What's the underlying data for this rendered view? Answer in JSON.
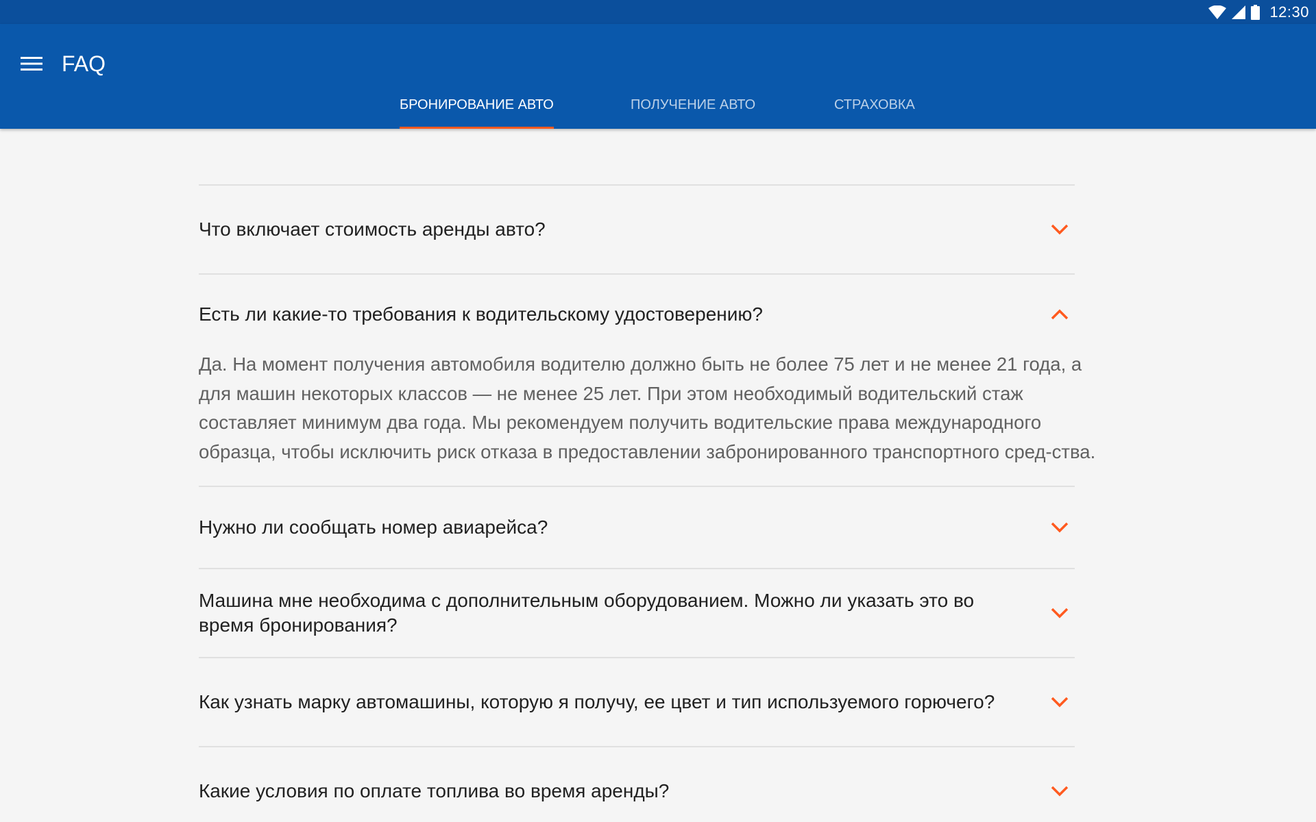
{
  "status_bar": {
    "time": "12:30",
    "icons": [
      "wifi-icon",
      "cell-signal-icon",
      "battery-icon"
    ]
  },
  "app_bar": {
    "title": "FAQ",
    "menu_icon": "menu-icon"
  },
  "tabs": [
    {
      "label": "БРОНИРОВАНИЕ АВТО",
      "active": true
    },
    {
      "label": "ПОЛУЧЕНИЕ АВТО",
      "active": false
    },
    {
      "label": "СТРАХОВКА",
      "active": false
    }
  ],
  "faq": [
    {
      "question": "Что включает стоимость аренды авто?",
      "expanded": false
    },
    {
      "question": "Есть ли какие-то требования к водительскому удостоверению?",
      "expanded": true,
      "answer": "Да. На момент получения автомобиля водителю должно быть не более 75 лет и не менее 21 года, а для машин некоторых классов — не менее 25 лет. При этом необходимый водительский стаж составляет минимум два года. Мы рекомендуем получить водительские права международного образца, чтобы исключить риск отказа в предоставлении забронированного транспортного сред-ства."
    },
    {
      "question": "Нужно ли сообщать номер авиарейса?",
      "expanded": false
    },
    {
      "question": "Машина мне необходима с дополнительным оборудованием. Можно ли указать это во время бронирования?",
      "expanded": false
    },
    {
      "question": "Как узнать марку автомашины, которую я получу, ее цвет и тип используемого горючего?",
      "expanded": false
    },
    {
      "question": "Какие условия по оплате топлива во время аренды?",
      "expanded": false
    }
  ],
  "colors": {
    "status_bar": "#0b4f9c",
    "app_bar": "#0a58ab",
    "accent": "#ff5a1f",
    "background": "#f5f5f5"
  }
}
